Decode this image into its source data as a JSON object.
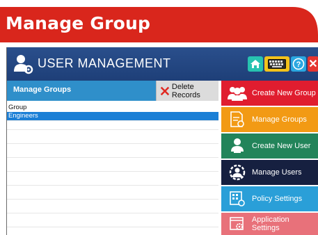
{
  "banner": {
    "title": "Manage Group",
    "color": "#d9261c"
  },
  "app": {
    "title": "USER MANAGEMENT",
    "header_buttons": [
      {
        "name": "home-icon"
      },
      {
        "name": "keyboard-icon"
      },
      {
        "name": "help-icon",
        "glyph": "?"
      },
      {
        "name": "close-icon",
        "glyph": "✕"
      }
    ]
  },
  "panel": {
    "title": "Manage Groups",
    "delete_label": "Delete Records",
    "column_header": "Group",
    "rows": [
      "Engineers"
    ]
  },
  "menu": {
    "items": [
      {
        "label": "Create New Group",
        "color": "#e01d2f",
        "icon": "group-icon"
      },
      {
        "label": "Manage Groups",
        "color": "#f29a14",
        "icon": "manage-groups-icon"
      },
      {
        "label": "Create New User",
        "color": "#22845a",
        "icon": "add-user-icon"
      },
      {
        "label": "Manage Users",
        "color": "#162040",
        "icon": "user-gear-icon"
      },
      {
        "label": "Policy Settings",
        "color": "#2a9fd8",
        "icon": "policy-icon"
      },
      {
        "label": "Application Settings",
        "color": "#e8717a",
        "icon": "app-settings-icon"
      }
    ]
  }
}
